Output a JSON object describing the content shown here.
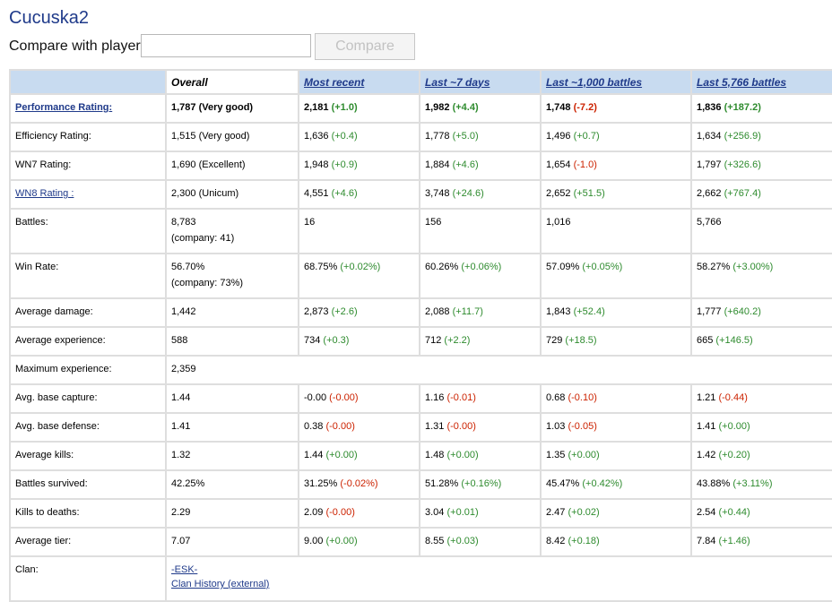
{
  "player": {
    "name": "Cucuska2"
  },
  "compare": {
    "label": "Compare with player",
    "input_value": "",
    "button_label": "Compare"
  },
  "table": {
    "headers": [
      "Overall",
      "Most recent",
      "Last ~7 days",
      "Last ~1,000 battles",
      "Last 5,766 battles"
    ],
    "rows": {
      "performance": {
        "label": "Performance Rating:",
        "overall": "1,787 (Very good)",
        "recent": {
          "v": "2,181",
          "d": "(+1.0)"
        },
        "week": {
          "v": "1,982",
          "d": "(+4.4)"
        },
        "k1000": {
          "v": "1,748",
          "d": "(-7.2)"
        },
        "k5766": {
          "v": "1,836",
          "d": "(+187.2)"
        }
      },
      "efficiency": {
        "label": "Efficiency Rating:",
        "overall": "1,515 (Very good)",
        "recent": {
          "v": "1,636",
          "d": "(+0.4)"
        },
        "week": {
          "v": "1,778",
          "d": "(+5.0)"
        },
        "k1000": {
          "v": "1,496",
          "d": "(+0.7)"
        },
        "k5766": {
          "v": "1,634",
          "d": "(+256.9)"
        }
      },
      "wn7": {
        "label": "WN7 Rating:",
        "overall": "1,690 (Excellent)",
        "recent": {
          "v": "1,948",
          "d": "(+0.9)"
        },
        "week": {
          "v": "1,884",
          "d": "(+4.6)"
        },
        "k1000": {
          "v": "1,654",
          "d": "(-1.0)"
        },
        "k5766": {
          "v": "1,797",
          "d": "(+326.6)"
        }
      },
      "wn8": {
        "label": "WN8 Rating :",
        "overall": "2,300 (Unicum)",
        "recent": {
          "v": "4,551",
          "d": "(+4.6)"
        },
        "week": {
          "v": "3,748",
          "d": "(+24.6)"
        },
        "k1000": {
          "v": "2,652",
          "d": "(+51.5)"
        },
        "k5766": {
          "v": "2,662",
          "d": "(+767.4)"
        }
      },
      "battles": {
        "label": "Battles:",
        "overall": "8,783",
        "overall_sub": "(company: 41)",
        "recent": "16",
        "week": "156",
        "k1000": "1,016",
        "k5766": "5,766"
      },
      "winrate": {
        "label": "Win Rate:",
        "overall": "56.70%",
        "overall_sub": "(company: 73%)",
        "recent": {
          "v": "68.75%",
          "d": "(+0.02%)"
        },
        "week": {
          "v": "60.26%",
          "d": "(+0.06%)"
        },
        "k1000": {
          "v": "57.09%",
          "d": "(+0.05%)"
        },
        "k5766": {
          "v": "58.27%",
          "d": "(+3.00%)"
        }
      },
      "damage": {
        "label": "Average damage:",
        "overall": "1,442",
        "recent": {
          "v": "2,873",
          "d": "(+2.6)"
        },
        "week": {
          "v": "2,088",
          "d": "(+11.7)"
        },
        "k1000": {
          "v": "1,843",
          "d": "(+52.4)"
        },
        "k5766": {
          "v": "1,777",
          "d": "(+640.2)"
        }
      },
      "experience": {
        "label": "Average experience:",
        "overall": "588",
        "recent": {
          "v": "734",
          "d": "(+0.3)"
        },
        "week": {
          "v": "712",
          "d": "(+2.2)"
        },
        "k1000": {
          "v": "729",
          "d": "(+18.5)"
        },
        "k5766": {
          "v": "665",
          "d": "(+146.5)"
        }
      },
      "maxexp": {
        "label": "Maximum experience:",
        "overall": "2,359"
      },
      "capture": {
        "label": "Avg. base capture:",
        "overall": "1.44",
        "recent": {
          "v": "-0.00",
          "d": "(-0.00)"
        },
        "week": {
          "v": "1.16",
          "d": "(-0.01)"
        },
        "k1000": {
          "v": "0.68",
          "d": "(-0.10)"
        },
        "k5766": {
          "v": "1.21",
          "d": "(-0.44)"
        }
      },
      "defense": {
        "label": "Avg. base defense:",
        "overall": "1.41",
        "recent": {
          "v": "0.38",
          "d": "(-0.00)"
        },
        "week": {
          "v": "1.31",
          "d": "(-0.00)"
        },
        "k1000": {
          "v": "1.03",
          "d": "(-0.05)"
        },
        "k5766": {
          "v": "1.41",
          "d": "(+0.00)"
        }
      },
      "kills": {
        "label": "Average kills:",
        "overall": "1.32",
        "recent": {
          "v": "1.44",
          "d": "(+0.00)"
        },
        "week": {
          "v": "1.48",
          "d": "(+0.00)"
        },
        "k1000": {
          "v": "1.35",
          "d": "(+0.00)"
        },
        "k5766": {
          "v": "1.42",
          "d": "(+0.20)"
        }
      },
      "survived": {
        "label": "Battles survived:",
        "overall": "42.25%",
        "recent": {
          "v": "31.25%",
          "d": "(-0.02%)"
        },
        "week": {
          "v": "51.28%",
          "d": "(+0.16%)"
        },
        "k1000": {
          "v": "45.47%",
          "d": "(+0.42%)"
        },
        "k5766": {
          "v": "43.88%",
          "d": "(+3.11%)"
        }
      },
      "kd": {
        "label": "Kills to deaths:",
        "overall": "2.29",
        "recent": {
          "v": "2.09",
          "d": "(-0.00)"
        },
        "week": {
          "v": "3.04",
          "d": "(+0.01)"
        },
        "k1000": {
          "v": "2.47",
          "d": "(+0.02)"
        },
        "k5766": {
          "v": "2.54",
          "d": "(+0.44)"
        }
      },
      "tier": {
        "label": "Average tier:",
        "overall": "7.07",
        "recent": {
          "v": "9.00",
          "d": "(+0.00)"
        },
        "week": {
          "v": "8.55",
          "d": "(+0.03)"
        },
        "k1000": {
          "v": "8.42",
          "d": "(+0.18)"
        },
        "k5766": {
          "v": "7.84",
          "d": "(+1.46)"
        }
      },
      "clan": {
        "label": "Clan:",
        "clan_name": "-ESK-",
        "clan_history": "Clan History (external)"
      }
    }
  },
  "colors": {
    "positive": "#2e8b2e",
    "negative": "#cc2200",
    "header_bg": "#c8dbf0",
    "link": "#1f3a8a"
  }
}
